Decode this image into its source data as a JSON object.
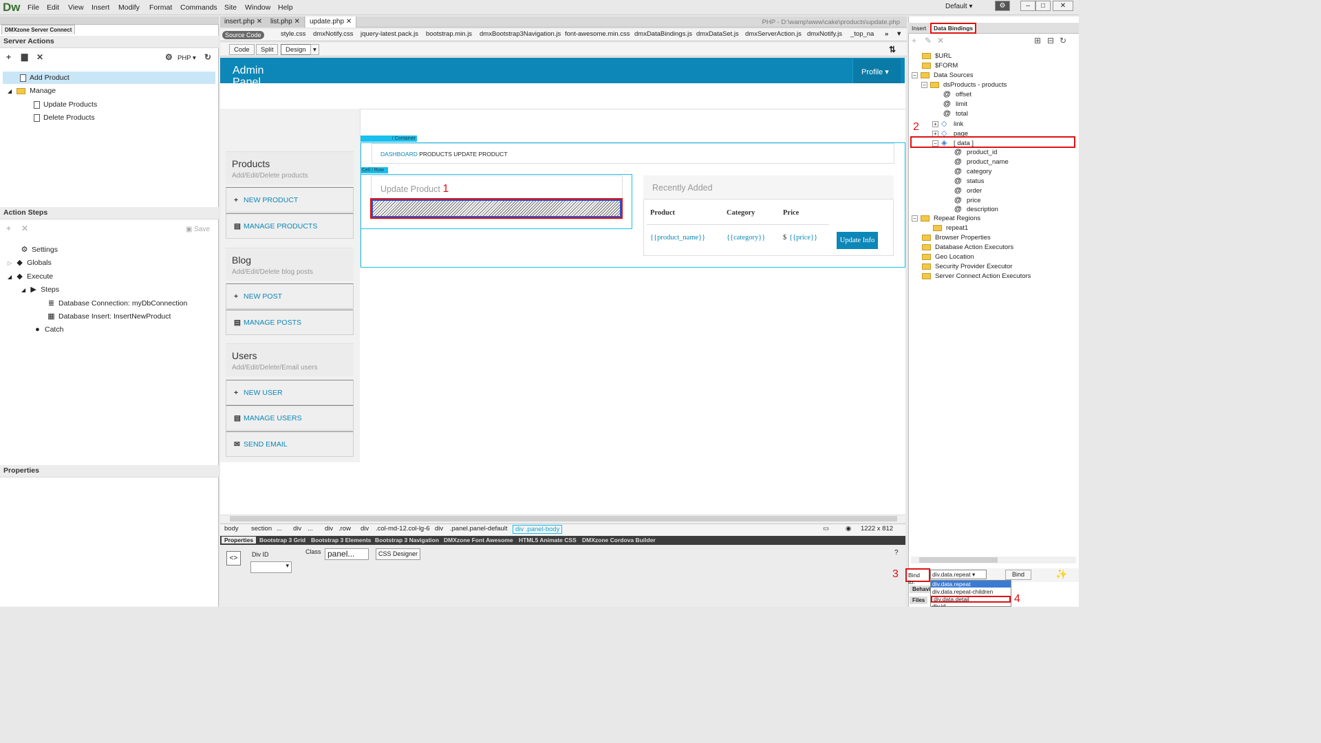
{
  "app": {
    "logo": "Dw",
    "workspace": "Default",
    "menu": [
      "File",
      "Edit",
      "View",
      "Insert",
      "Modify",
      "Format",
      "Commands",
      "Site",
      "Window",
      "Help"
    ]
  },
  "left": {
    "panel_tab": "DMXzone Server Connect",
    "server_actions_title": "Server Actions",
    "lang": "PHP",
    "actions": [
      {
        "label": "Add Product"
      },
      {
        "label": "Manage"
      },
      {
        "label": "Update Products"
      },
      {
        "label": "Delete Products"
      }
    ],
    "action_steps_title": "Action Steps",
    "save_label": "Save",
    "steps": [
      {
        "label": "Settings"
      },
      {
        "label": "Globals"
      },
      {
        "label": "Execute"
      },
      {
        "label": "Steps"
      },
      {
        "label": "Database Connection: myDbConnection"
      },
      {
        "label": "Database Insert: InsertNewProduct"
      },
      {
        "label": "Catch"
      }
    ],
    "properties_title": "Properties"
  },
  "doc": {
    "tabs": [
      "insert.php",
      "list.php",
      "update.php"
    ],
    "path": "PHP - D:\\wamp\\www\\cake\\products\\update.php",
    "source_code": "Source Code",
    "related": [
      "style.css",
      "dmxNotify.css",
      "jquery-latest.pack.js",
      "bootstrap.min.js",
      "dmxBootstrap3Navigation.js",
      "font-awesome.min.css",
      "dmxDataBindings.js",
      "dmxDataSet.js",
      "dmxServerAction.js",
      "dmxNotify.js",
      "_top_na"
    ],
    "views": [
      "Code",
      "Split",
      "Design"
    ]
  },
  "page": {
    "admin_title": "Admin Panel",
    "profile": "Profile",
    "sidebar": [
      {
        "title": "Products",
        "sub": "Add/Edit/Delete products",
        "links": [
          {
            "icon": "+",
            "label": "NEW PRODUCT"
          },
          {
            "icon": "▤",
            "label": "MANAGE PRODUCTS"
          }
        ]
      },
      {
        "title": "Blog",
        "sub": "Add/Edit/Delete blog posts",
        "links": [
          {
            "icon": "+",
            "label": "NEW POST"
          },
          {
            "icon": "▤",
            "label": "MANAGE POSTS"
          }
        ]
      },
      {
        "title": "Users",
        "sub": "Add/Edit/Delete/Email users",
        "links": [
          {
            "icon": "+",
            "label": "NEW USER"
          },
          {
            "icon": "▤",
            "label": "MANAGE USERS"
          },
          {
            "icon": "✉",
            "label": "SEND EMAIL"
          }
        ]
      }
    ],
    "container_tag": "/ Container",
    "cellrow_tag": "Cell / Row",
    "breadcrumb": {
      "dashboard": "DASHBOARD",
      "rest": "PRODUCTS UPDATE PRODUCT"
    },
    "update_title": "Update Product",
    "annotation_1": "1",
    "recent_title": "Recently Added",
    "table": {
      "headers": [
        "Product",
        "Category",
        "Price"
      ],
      "cells": [
        "{{product_name}}",
        "{{category}}",
        "{{price}}"
      ],
      "currency": "$",
      "button": "Update Info"
    }
  },
  "tagsel": [
    "body",
    "section",
    "...",
    "div",
    "...",
    "div",
    ".row",
    "div",
    ".col-md-12.col-lg-6",
    "div",
    ".panel.panel-default",
    "div",
    ".panel-body"
  ],
  "size": "1222 x 812",
  "prop_tabs": [
    "Properties",
    "Bootstrap 3 Grid",
    "Bootstrap 3 Elements",
    "Bootstrap 3 Navigation",
    "DMXzone Font Awesome",
    "HTML5 Animate CSS",
    "DMXzone Cordova Builder"
  ],
  "props": {
    "divid": "Div ID",
    "class_label": "Class",
    "class_val": "panel...",
    "css_designer": "CSS Designer"
  },
  "right": {
    "tabs": [
      "Insert",
      "Data Bindings"
    ],
    "tree": [
      {
        "label": "$URL"
      },
      {
        "label": "$FORM"
      },
      {
        "label": "Data Sources"
      },
      {
        "label": "dsProducts - products"
      },
      {
        "label": "offset"
      },
      {
        "label": "limit"
      },
      {
        "label": "total"
      },
      {
        "label": "link"
      },
      {
        "label": "page"
      },
      {
        "label": "[ data ]"
      },
      {
        "label": "product_id"
      },
      {
        "label": "product_name"
      },
      {
        "label": "category"
      },
      {
        "label": "status"
      },
      {
        "label": "order"
      },
      {
        "label": "price"
      },
      {
        "label": "description"
      },
      {
        "label": "Repeat Regions"
      },
      {
        "label": "repeat1"
      },
      {
        "label": "Browser Properties"
      },
      {
        "label": "Database Action Executors"
      },
      {
        "label": "Geo Location"
      },
      {
        "label": "Security Provider Executor"
      },
      {
        "label": "Server Connect Action Executors"
      }
    ],
    "annotation_2": "2",
    "annotation_3": "3",
    "annotation_4": "4",
    "bind_to": "Bind to:",
    "bind_value": "div.data.repeat",
    "bind_btn": "Bind",
    "options": [
      "div.data.repeat",
      "div.data.repeat-children",
      "div.data.detail",
      "div.id"
    ],
    "behaviors": "Behavio",
    "files": "Files"
  }
}
